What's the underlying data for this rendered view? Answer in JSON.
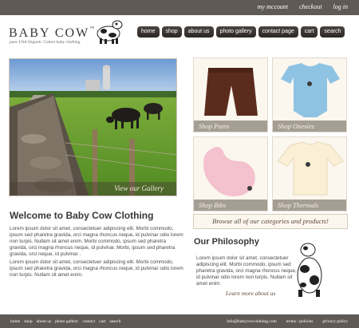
{
  "top_links": [
    "my mccount",
    "checkout",
    "log in"
  ],
  "logo": {
    "text": "BABY COW",
    "tm": "™",
    "tagline": "pure USA Organic Cotton baby clothing"
  },
  "nav": [
    "home",
    "shop",
    "about us",
    "photo gallery",
    "contact page",
    "cart",
    "search"
  ],
  "hero": {
    "caption": "View our Gallery"
  },
  "tiles": [
    "Shop Pants",
    "Shop Onesies",
    "Shop Bibs",
    "Shop Thermals"
  ],
  "banner": "Browse all of our categories and products!",
  "welcome": {
    "title": "Welcome to Baby Cow Clothing",
    "p1": "Lorem ipsum dolor sit amet, consectetuer adipiscing elit. Morbi commodo, ipsum sed pharetra gravida, orci magna rhoncus neque, id pulvinar odio lorem non turpis. Nullam sit amet enim. Morbi commodo, ipsum sed pharetra gravida, orci magna rhoncus neque, id pulvinar. Morbi, ipsum sed pharetra gravida, orci neque, id pulvinar .",
    "p2": "Lorem ipsum dolor sit amet, consectetuer adipiscing elit. Morbi commodo, ipsum sed pharetra gravida, orci magna rhoncus neque, id pulvinar odio lorem non turpis. Nullam sit amet enim."
  },
  "philosophy": {
    "title": "Our Philosophy",
    "p": "Lorem ipsum dolor sit amet, consectetuer adipiscing elit. Morbi commodo, ipsum sed pharetra gravida, orci magna rhoncus neque, id pulvinar odio lorem non turpis. Nullam sit amet enim.",
    "link": "Learn more about us"
  },
  "footer": {
    "left": [
      "home",
      "shop",
      "about us",
      "photo gallery",
      "contact",
      "cart",
      "search"
    ],
    "right": [
      "info@babycowclothing.com",
      "terms / policies",
      "privacy policy"
    ]
  },
  "colors": {
    "bar": "#5f5a56",
    "nav_button": "#2c2826",
    "caption_text": "#f4ede2",
    "accent_brown": "#5d4a3c"
  },
  "icons": [
    "cow-icon"
  ]
}
